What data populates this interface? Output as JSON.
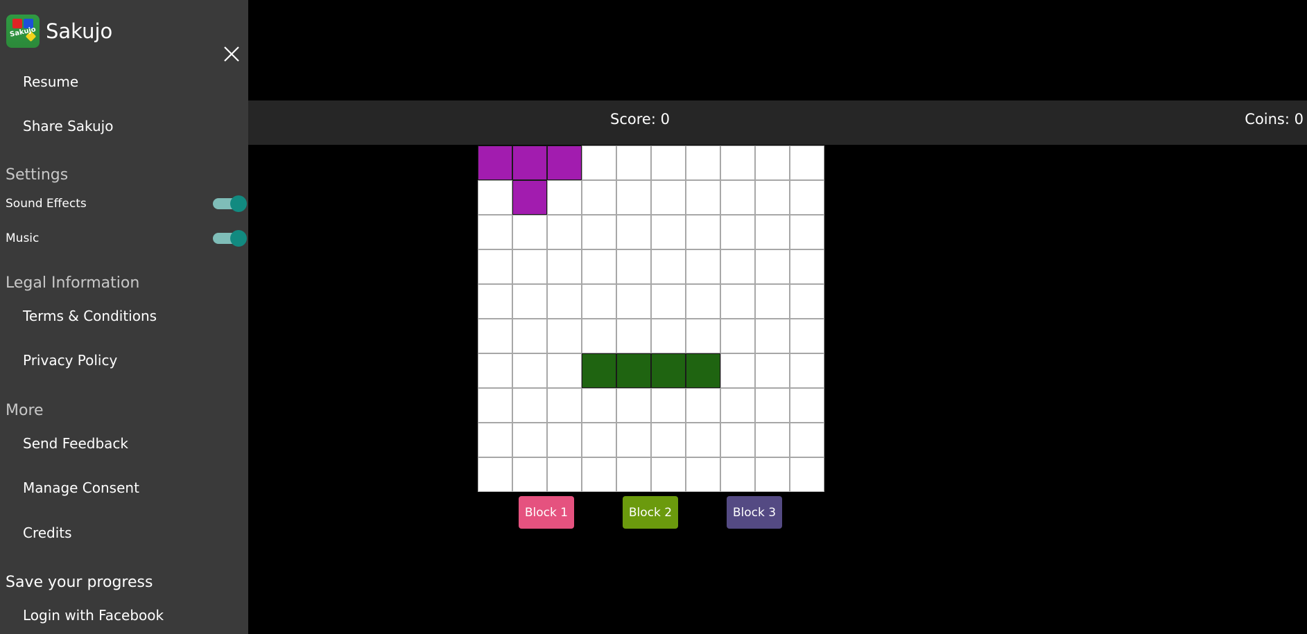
{
  "app": {
    "title": "Sakujo",
    "logo_text": "Sakujo"
  },
  "sidebar": {
    "nav": [
      {
        "label": "Resume"
      },
      {
        "label": "Share Sakujo"
      }
    ],
    "settings": {
      "heading": "Settings",
      "sound_effects": {
        "label": "Sound Effects",
        "on": true
      },
      "music": {
        "label": "Music",
        "on": true
      }
    },
    "legal": {
      "heading": "Legal Information",
      "items": [
        {
          "label": "Terms & Conditions"
        },
        {
          "label": "Privacy Policy"
        }
      ]
    },
    "more": {
      "heading": "More",
      "items": [
        {
          "label": "Send Feedback"
        },
        {
          "label": "Manage Consent"
        },
        {
          "label": "Credits"
        }
      ]
    },
    "save": {
      "heading": "Save your progress",
      "login_label": "Login with Facebook"
    }
  },
  "header": {
    "score_label": "Score: 0",
    "coins_label": "Coins: 0"
  },
  "board": {
    "rows": 10,
    "cols": 10,
    "filled": [
      {
        "row": 0,
        "col": 0,
        "color": "#a21caf"
      },
      {
        "row": 0,
        "col": 1,
        "color": "#a21caf"
      },
      {
        "row": 0,
        "col": 2,
        "color": "#a21caf"
      },
      {
        "row": 1,
        "col": 1,
        "color": "#a21caf"
      },
      {
        "row": 6,
        "col": 3,
        "color": "#1f6411"
      },
      {
        "row": 6,
        "col": 4,
        "color": "#1f6411"
      },
      {
        "row": 6,
        "col": 5,
        "color": "#1f6411"
      },
      {
        "row": 6,
        "col": 6,
        "color": "#1f6411"
      }
    ]
  },
  "blocks": [
    {
      "label": "Block 1",
      "color": "#e5527f"
    },
    {
      "label": "Block 2",
      "color": "#6b9a0d"
    },
    {
      "label": "Block 3",
      "color": "#544a83"
    }
  ],
  "colors": {
    "sidebar_bg": "#3a3a3a",
    "header_bg": "#262626",
    "toggle_on": "#128a80",
    "grid_line": "#a7a7a7"
  }
}
